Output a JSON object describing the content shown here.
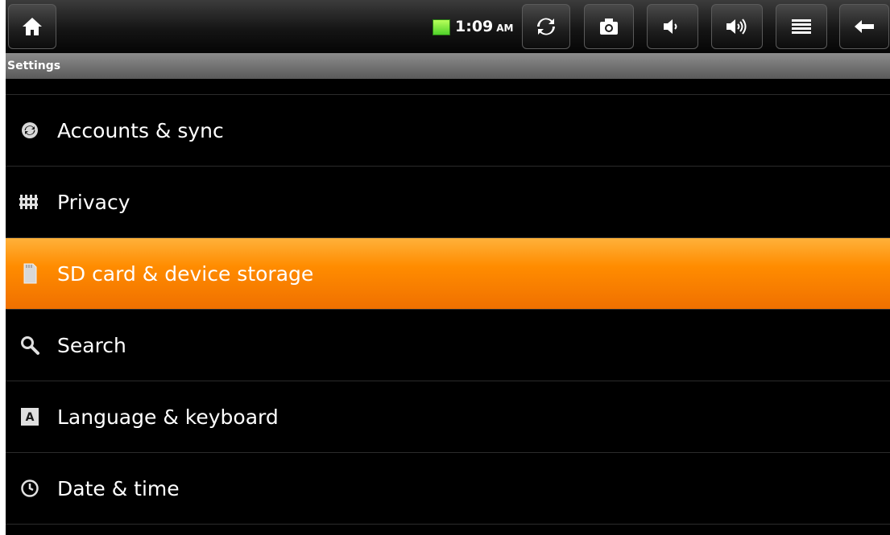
{
  "status_bar": {
    "time": "1:09",
    "ampm": "AM",
    "buttons": [
      {
        "name": "home-icon"
      },
      {
        "name": "refresh-icon"
      },
      {
        "name": "camera-icon"
      },
      {
        "name": "volume-down-icon"
      },
      {
        "name": "volume-up-icon"
      },
      {
        "name": "menu-icon"
      },
      {
        "name": "back-icon"
      }
    ],
    "battery_color": "#4fd22a"
  },
  "title_bar": {
    "title": "Settings"
  },
  "settings": {
    "items": [
      {
        "label": "Accounts & sync",
        "icon": "sync-icon",
        "selected": false
      },
      {
        "label": "Privacy",
        "icon": "privacy-icon",
        "selected": false
      },
      {
        "label": "SD card & device storage",
        "icon": "sd-card-icon",
        "selected": true
      },
      {
        "label": "Search",
        "icon": "search-icon",
        "selected": false
      },
      {
        "label": "Language & keyboard",
        "icon": "keyboard-icon",
        "selected": false
      },
      {
        "label": "Date & time",
        "icon": "clock-icon",
        "selected": false
      }
    ]
  },
  "colors": {
    "selection": "#ff8c00",
    "background": "#000000",
    "title_bar": "#6e6e6e"
  }
}
